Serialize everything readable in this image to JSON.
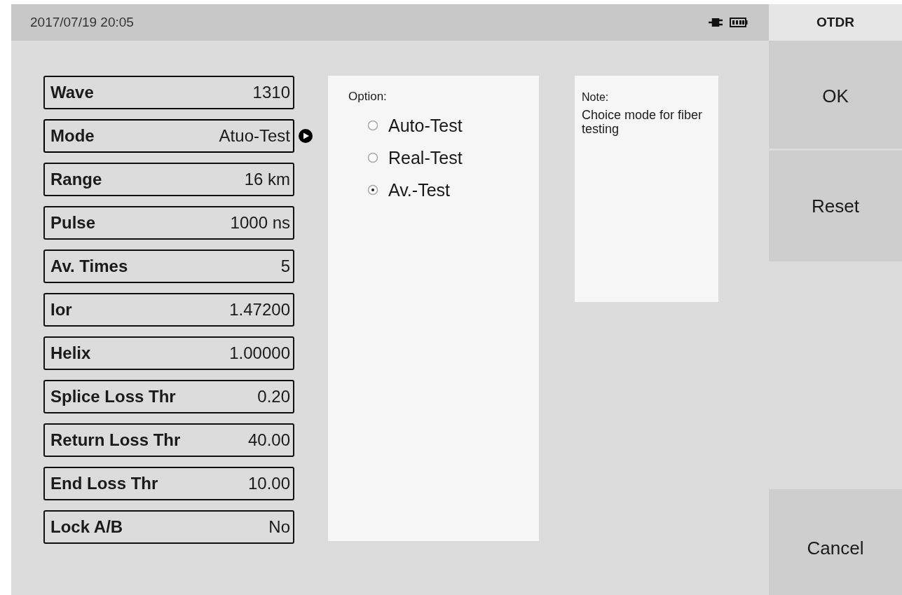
{
  "status_bar": {
    "datetime": "2017/07/19 20:05"
  },
  "side_panel": {
    "title": "OTDR",
    "buttons": [
      {
        "kind": "ok",
        "label": "OK"
      },
      {
        "kind": "reset",
        "label": "Reset"
      },
      {
        "kind": "cancel",
        "label": "Cancel"
      }
    ]
  },
  "parameters": [
    {
      "name": "Wave",
      "value": "1310",
      "selected": false
    },
    {
      "name": "Mode",
      "value": "Atuo-Test",
      "selected": true
    },
    {
      "name": "Range",
      "value": "16 km",
      "selected": false
    },
    {
      "name": "Pulse",
      "value": "1000 ns",
      "selected": false
    },
    {
      "name": "Av. Times",
      "value": "5",
      "selected": false
    },
    {
      "name": "Ior",
      "value": "1.47200",
      "selected": false
    },
    {
      "name": "Helix",
      "value": "1.00000",
      "selected": false
    },
    {
      "name": "Splice Loss Thr",
      "value": "0.20",
      "selected": false
    },
    {
      "name": "Return Loss Thr",
      "value": "40.00",
      "selected": false
    },
    {
      "name": "End Loss Thr",
      "value": "10.00",
      "selected": false
    },
    {
      "name": "Lock A/B",
      "value": "No",
      "selected": false
    }
  ],
  "options": {
    "title": "Option:",
    "items": [
      {
        "label": "Auto-Test",
        "selected": false
      },
      {
        "label": "Real-Test",
        "selected": false
      },
      {
        "label": "Av.-Test",
        "selected": true
      }
    ]
  },
  "note": {
    "title": "Note:",
    "text": "Choice mode for fiber testing"
  }
}
